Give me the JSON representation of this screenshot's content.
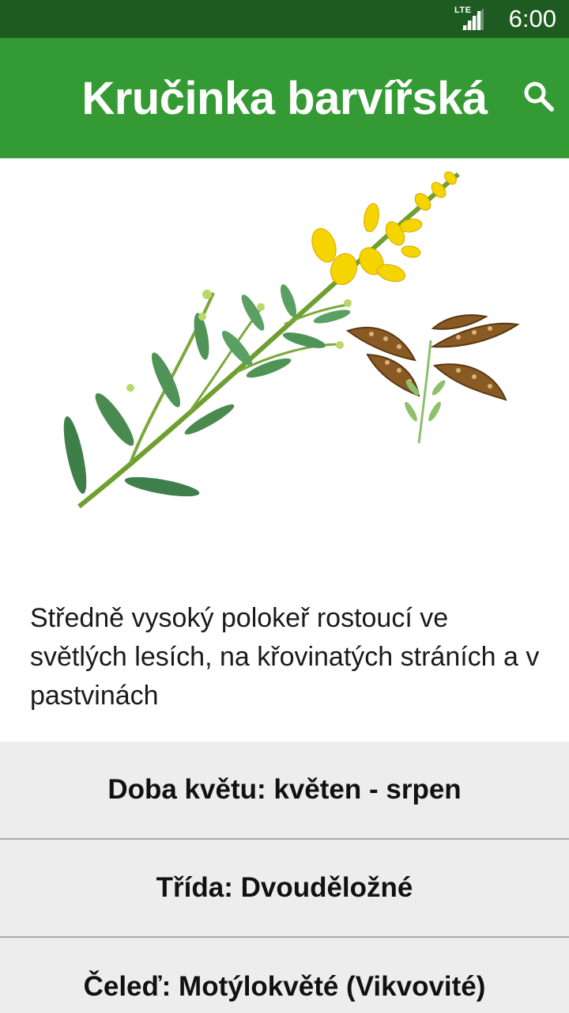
{
  "status_bar": {
    "network": "LTE",
    "time": "6:00"
  },
  "app_bar": {
    "title": "Kručinka barvířská",
    "search_icon": "search-icon"
  },
  "illustration": {
    "icon": "plant-illustration"
  },
  "description": "Středně vysoký polokeř rostoucí ve světlých lesích, na křovinatých stráních a v pastvinách",
  "info": [
    {
      "text": "Doba květu: květen - srpen"
    },
    {
      "text": "Třída: Dvouděložné"
    },
    {
      "text": "Čeleď: Motýlokvěté (Vikvovité)"
    }
  ]
}
